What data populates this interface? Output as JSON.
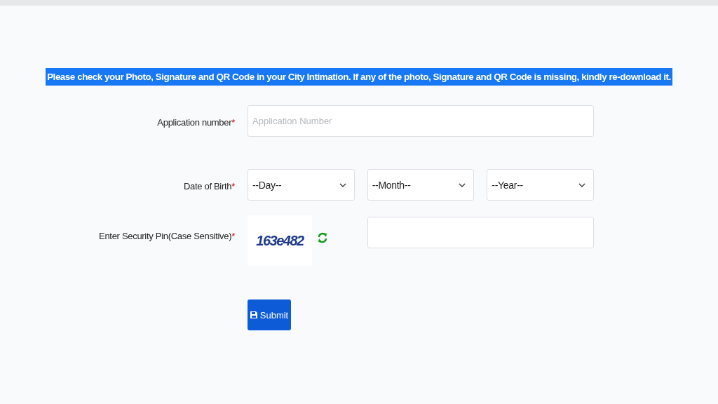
{
  "notice": "Please check your Photo, Signature and QR Code in your City Intimation. If any of the photo, Signature and QR Code is missing, kindly re-download it.",
  "form": {
    "application": {
      "label": "Application number",
      "required_mark": "*",
      "placeholder": "Application Number"
    },
    "dob": {
      "label": "Date of Birth",
      "required_mark": "*",
      "selects": [
        "--Day--",
        "--Month--",
        "--Year--"
      ]
    },
    "captcha": {
      "label": "Enter Security Pin(Case Sensitive)",
      "required_mark": "*",
      "code": "163e482"
    },
    "submit": "Submit"
  }
}
